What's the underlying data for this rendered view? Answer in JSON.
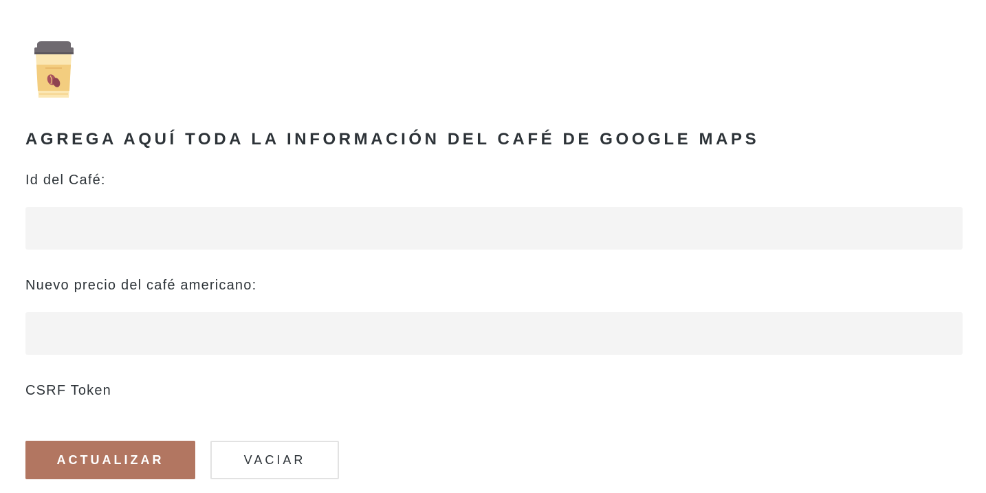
{
  "logo": {
    "icon": "coffee-cup-icon",
    "colors": {
      "lid": "#6f6a70",
      "cup": "#fbe7b4",
      "sleeve": "#f3cd7f",
      "bean": "#a9525d"
    }
  },
  "form": {
    "title": "AGREGA AQUÍ TODA LA INFORMACIÓN DEL CAFÉ DE GOOGLE MAPS",
    "fields": [
      {
        "label": "Id del Café:",
        "value": "",
        "placeholder": ""
      },
      {
        "label": "Nuevo precio del café americano:",
        "value": "",
        "placeholder": ""
      }
    ],
    "csrf_label": "CSRF Token",
    "buttons": {
      "submit_label": "ACTUALIZAR",
      "reset_label": "VACIAR"
    }
  },
  "colors": {
    "accent": "#b27661",
    "text": "#2d3338",
    "input_background": "#f4f4f4",
    "secondary_border": "#e2e2e2"
  }
}
